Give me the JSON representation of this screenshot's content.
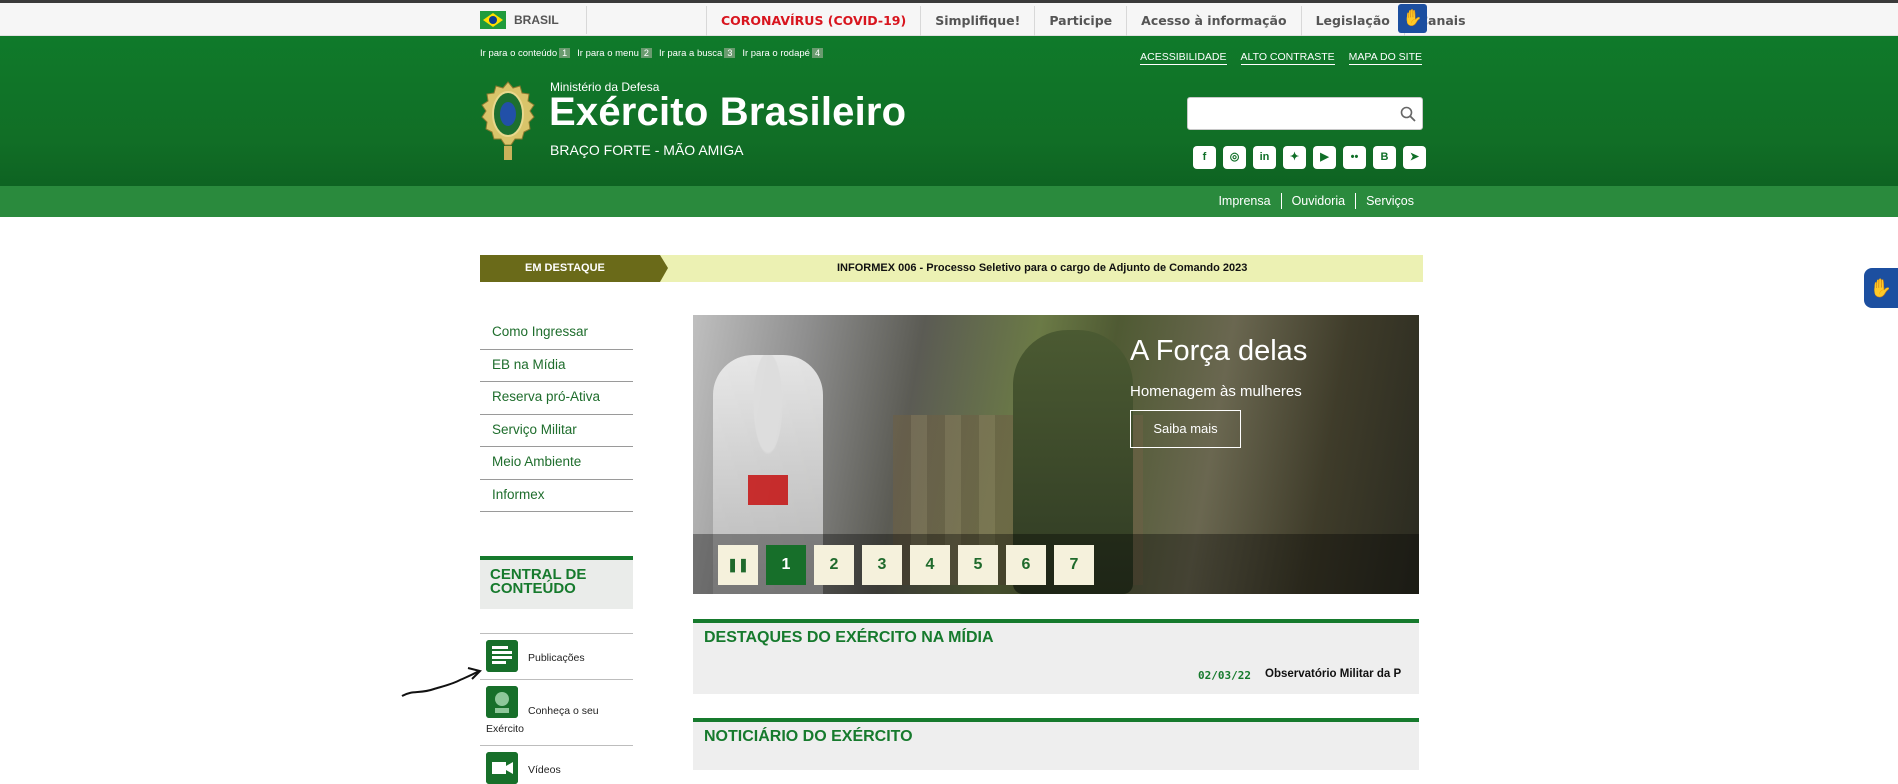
{
  "gov_bar": {
    "country": "BRASIL",
    "links": [
      "CORONAVÍRUS (COVID-19)",
      "Simplifique!",
      "Participe",
      "Acesso à informação",
      "Legislação",
      "Canais"
    ]
  },
  "skip_links": [
    {
      "label": "Ir para o conteúdo",
      "key": "1"
    },
    {
      "label": "Ir para o menu",
      "key": "2"
    },
    {
      "label": "Ir para a busca",
      "key": "3"
    },
    {
      "label": "Ir para o rodapé",
      "key": "4"
    }
  ],
  "accessibility_links": [
    "ACESSIBILIDADE",
    "ALTO CONTRASTE",
    "MAPA DO SITE"
  ],
  "site": {
    "ministry": "Ministério da Defesa",
    "title": "Exército Brasileiro",
    "motto": "BRAÇO FORTE - MÃO AMIGA"
  },
  "search": {
    "placeholder": ""
  },
  "social_icons": [
    "facebook-icon",
    "instagram-icon",
    "linkedin-icon",
    "twitter-icon",
    "youtube-icon",
    "flickr-icon",
    "blogger-icon",
    "telegram-icon"
  ],
  "sub_nav": [
    "Imprensa",
    "Ouvidoria",
    "Serviços"
  ],
  "highlight": {
    "tag": "EM DESTAQUE",
    "text": "INFORMEX 006 - Processo Seletivo para o cargo de Adjunto de Comando 2023"
  },
  "side_menu": [
    "Como Ingressar",
    "EB na Mídia",
    "Reserva pró-Ativa",
    "Serviço Militar",
    "Meio Ambiente",
    "Informex"
  ],
  "central": {
    "title": "CENTRAL DE CONTEÚDO",
    "items": [
      "Publicações",
      "Conheça o seu",
      "Exército",
      "Vídeos"
    ]
  },
  "banner": {
    "title": "A Força delas",
    "subtitle": "Homenagem às mulheres",
    "button": "Saiba mais",
    "pages": [
      "1",
      "2",
      "3",
      "4",
      "5",
      "6",
      "7"
    ],
    "active_page": "1"
  },
  "media": {
    "title": "DESTAQUES DO EXÉRCITO NA MÍDIA",
    "date": "02/03/22",
    "headline": "Observatório Militar da P"
  },
  "news": {
    "title": "NOTICIÁRIO DO EXÉRCITO"
  }
}
